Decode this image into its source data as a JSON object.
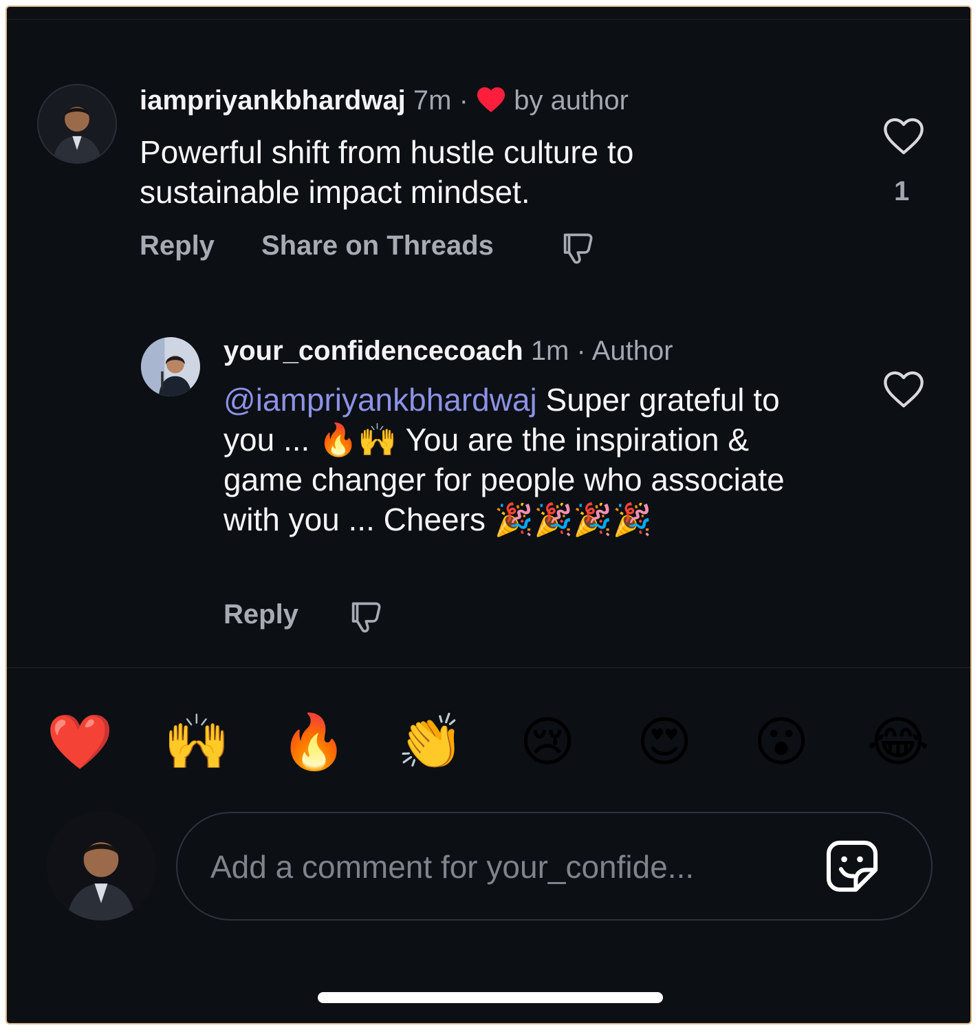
{
  "comments": [
    {
      "username": "iampriyankbhardwaj",
      "time": "7m",
      "separator": "·",
      "liked_by_author": "by author",
      "text": "Powerful shift from hustle culture to sustainable impact mindset.",
      "like_count": "1",
      "actions": {
        "reply": "Reply",
        "share": "Share on Threads"
      }
    },
    {
      "username": "your_confidencecoach",
      "time": "1m",
      "separator": "·",
      "badge": "Author",
      "mention": "@iampriyankbhardwaj",
      "text": " Super grateful to you ... 🔥🙌 You are the inspiration & game changer  for people who associate with you ... Cheers 🎉🎉🎉🎉",
      "actions": {
        "reply": "Reply"
      }
    }
  ],
  "reactions": [
    "❤️",
    "🙌",
    "🔥",
    "👏",
    "😢",
    "😍",
    "😮",
    "😂"
  ],
  "composer": {
    "placeholder": "Add a comment for your_confide..."
  },
  "colors": {
    "background": "#0c0f14",
    "mention": "#8d92e6",
    "heart": "#ff1f3d",
    "muted": "#a3a7ae"
  }
}
